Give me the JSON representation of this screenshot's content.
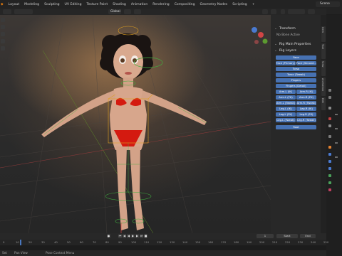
{
  "menu": {
    "items": [
      "Layout",
      "Modeling",
      "Sculpting",
      "UV Editing",
      "Texture Paint",
      "Shading",
      "Animation",
      "Rendering",
      "Compositing",
      "Geometry Nodes",
      "Scripting",
      "+"
    ],
    "scene": "Scene"
  },
  "header": {
    "transform_orientation": "Global",
    "pose_options": "Pose Options"
  },
  "npanel": {
    "tabs": [
      "Item",
      "Tool",
      "View",
      "Animation",
      "Edit"
    ],
    "transform": "Transform",
    "no_bone": "No Bone Active",
    "rig_main": "Rig Main Properties",
    "rig_layers": "Rig Layers",
    "buttons": [
      {
        "label": "Face",
        "full": true
      },
      {
        "label": "Face (Primary)",
        "half": "Face (Second..."
      },
      {
        "label": "Torso",
        "full": true
      },
      {
        "label": "Torso (Tweak)",
        "full": true
      },
      {
        "label": "Fingers",
        "full": true
      },
      {
        "label": "Fingers (Detail)",
        "full": true
      }
    ],
    "pairs": [
      [
        "Arm.L (IK)",
        "Arm.R (IK)"
      ],
      [
        "Arm.L (FK)",
        "Arm.R (FK)"
      ],
      [
        "Arm.L (Tweak)",
        "Arm.R (Tweak)"
      ],
      [
        "Leg.L (IK)",
        "Leg.R (IK)"
      ],
      [
        "Leg.L (FK)",
        "Leg.R (FK)"
      ],
      [
        "Leg.L (Tweak)",
        "Leg.R (Tweak)"
      ]
    ],
    "root": "Root"
  },
  "timeline": {
    "current_frame": "1",
    "fields": [
      "1",
      "1",
      "1"
    ],
    "start_label": "Start",
    "end_label": "End",
    "ticks": [
      "0",
      "10",
      "20",
      "30",
      "40",
      "50",
      "60",
      "70",
      "80",
      "90",
      "100",
      "110",
      "120",
      "130",
      "140",
      "150",
      "160",
      "170",
      "180",
      "190",
      "200",
      "210",
      "220",
      "230",
      "240",
      "250"
    ],
    "status": [
      "Set",
      "Pan View",
      "Pose Context Menu"
    ]
  }
}
